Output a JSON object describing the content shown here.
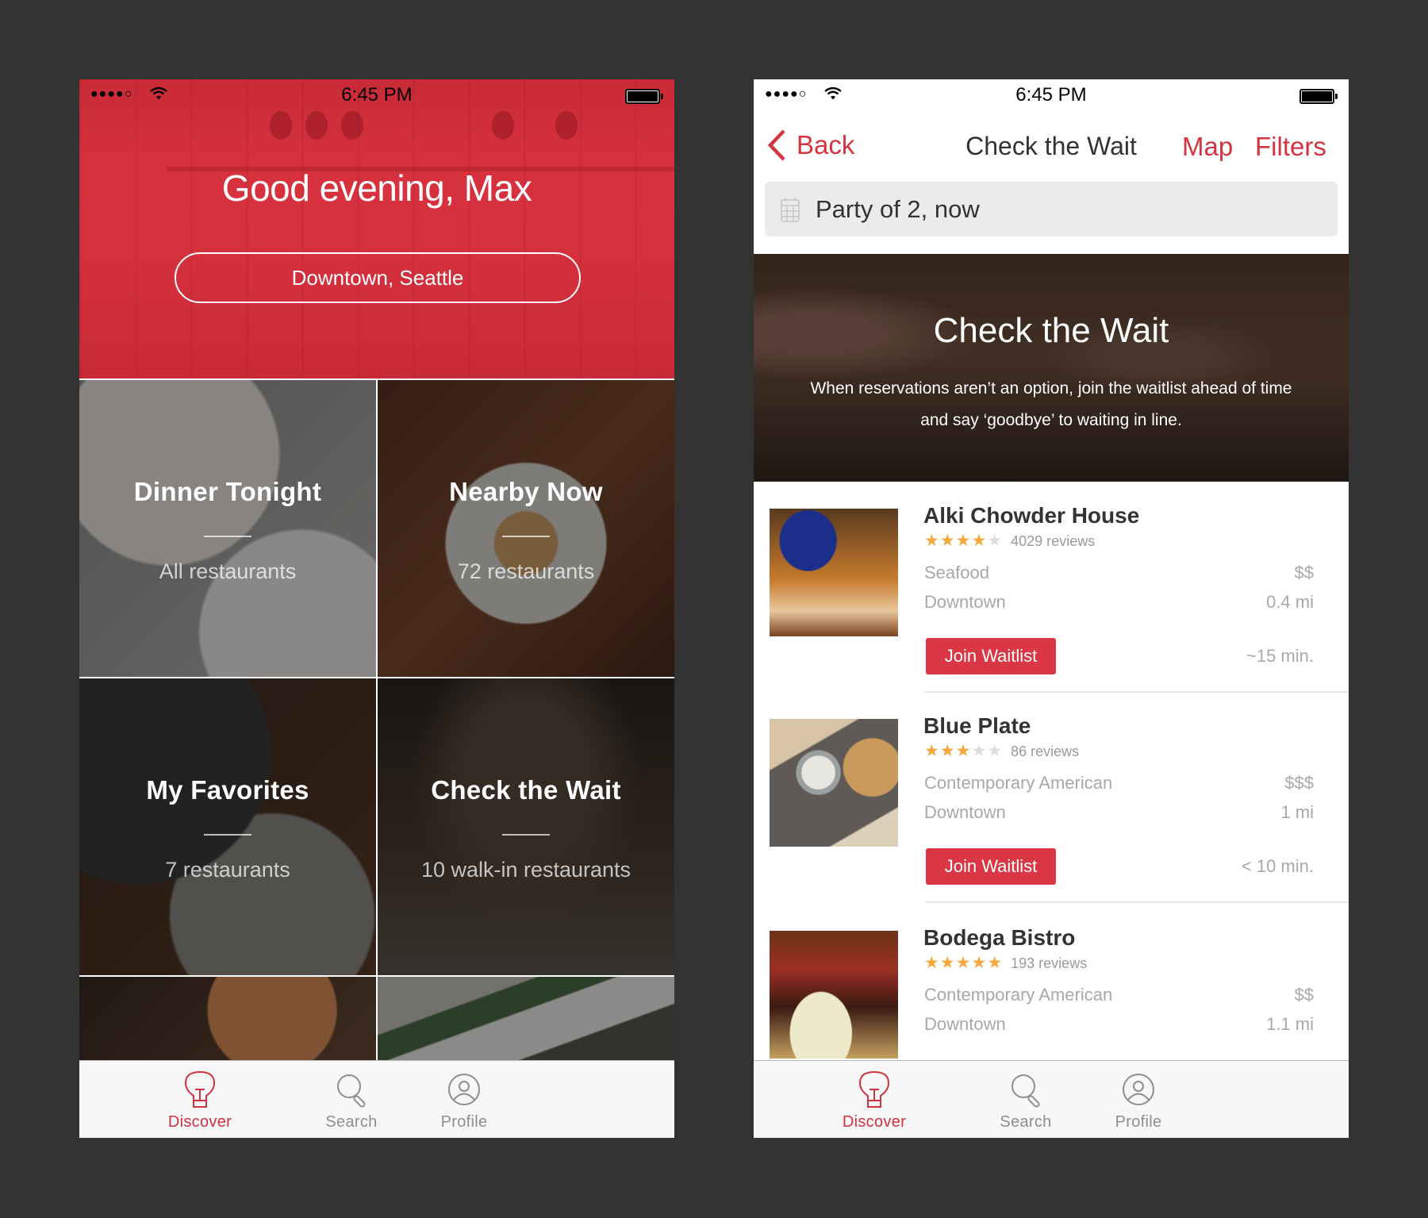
{
  "colors": {
    "accent": "#d63341",
    "star_filled": "#f5a83c",
    "star_empty": "#dddddd",
    "background": "#333333",
    "tab_inactive": "#8e8e8e"
  },
  "status_bar": {
    "signal": "●●●●○",
    "wifi_icon": "wifi-icon",
    "time": "6:45 PM",
    "battery_icon": "battery-full-icon"
  },
  "discover_screen": {
    "greeting": "Good evening, Max",
    "location_button": "Downtown, Seattle",
    "tiles": [
      {
        "title": "Dinner Tonight",
        "subtitle": "All restaurants"
      },
      {
        "title": "Nearby Now",
        "subtitle": "72 restaurants"
      },
      {
        "title": "My Favorites",
        "subtitle": "7 restaurants"
      },
      {
        "title": "Check the Wait",
        "subtitle": "10 walk-in restaurants"
      },
      {
        "title": "",
        "subtitle": ""
      },
      {
        "title": "",
        "subtitle": ""
      }
    ]
  },
  "wait_screen": {
    "nav": {
      "back_label": "Back",
      "title": "Check the Wait",
      "map_label": "Map",
      "filters_label": "Filters"
    },
    "party_field": {
      "icon": "calendar-icon",
      "value": "Party of 2, now"
    },
    "banner": {
      "title": "Check the Wait",
      "description": "When reservations aren’t an option, join the waitlist ahead of time and say ‘goodbye’ to waiting in line."
    },
    "restaurants": [
      {
        "name": "Alki Chowder House",
        "rating": 4,
        "max_rating": 5,
        "reviews": "4029 reviews",
        "cuisine": "Seafood",
        "price": "$$",
        "area": "Downtown",
        "distance": "0.4 mi",
        "button": "Join Waitlist",
        "wait": "~15 min."
      },
      {
        "name": "Blue Plate",
        "rating": 3,
        "max_rating": 5,
        "reviews": "86 reviews",
        "cuisine": "Contemporary American",
        "price": "$$$",
        "area": "Downtown",
        "distance": "1 mi",
        "button": "Join Waitlist",
        "wait": "< 10 min."
      },
      {
        "name": "Bodega Bistro",
        "rating": 5,
        "max_rating": 5,
        "reviews": "193 reviews",
        "cuisine": "Contemporary American",
        "price": "$$",
        "area": "Downtown",
        "distance": "1.1 mi",
        "button": "",
        "wait": ""
      }
    ]
  },
  "tab_bar": {
    "tabs": [
      {
        "label": "Discover",
        "icon": "lightbulb-icon",
        "active": true
      },
      {
        "label": "Search",
        "icon": "search-icon",
        "active": false
      },
      {
        "label": "Profile",
        "icon": "profile-icon",
        "active": false
      }
    ]
  }
}
